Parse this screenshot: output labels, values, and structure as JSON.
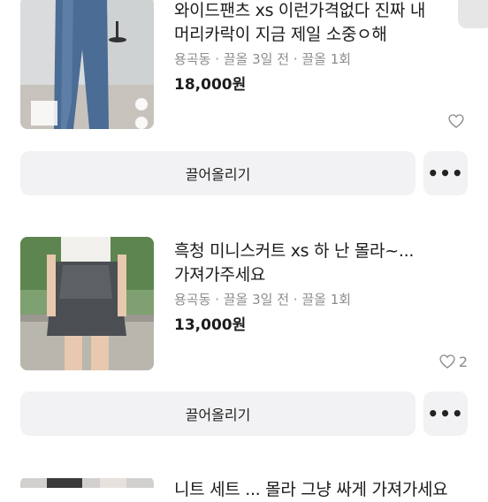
{
  "listings": [
    {
      "title": "와이드팬츠 xs 이런가격없다 진짜 내\n머리카락이 지금 제일 소중ㅇ해",
      "location": "용곡동",
      "bumped": "끌올 3일 전",
      "bump_count": "끌올 1회",
      "price": "18,000원",
      "likes": "",
      "bump_label": "끌어올리기",
      "more_label": "•••"
    },
    {
      "title": "흑청 미니스커트 xs 하 난 몰라~...\n가져가주세요",
      "location": "용곡동",
      "bumped": "끌올 3일 전",
      "bump_count": "끌올 1회",
      "price": "13,000원",
      "likes": "2",
      "bump_label": "끌어올리기",
      "more_label": "•••"
    },
    {
      "title": "니트 세트 ... 몰라 그냥 싸게 가져가세요"
    }
  ],
  "separator": "·"
}
